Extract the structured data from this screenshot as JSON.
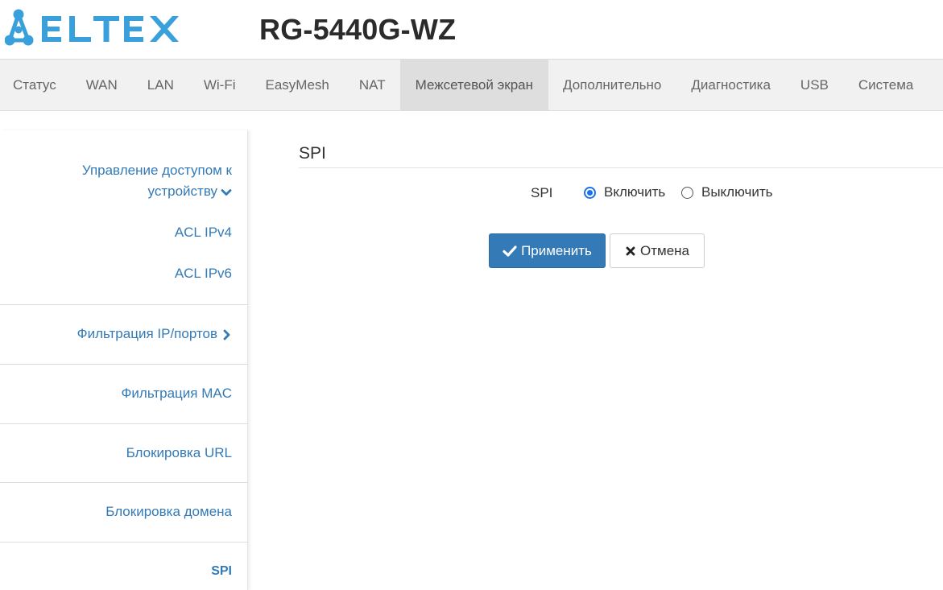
{
  "header": {
    "logo_text": "ELTEX",
    "model": "RG-5440G-WZ"
  },
  "topnav": {
    "tabs": [
      "Статус",
      "WAN",
      "LAN",
      "Wi-Fi",
      "EasyMesh",
      "NAT",
      "Межсетевой экран",
      "Дополнительно",
      "Диагностика",
      "USB",
      "Система"
    ],
    "active": "Межсетевой экран"
  },
  "sidebar": {
    "group_label": "Управление доступом к устройству",
    "acl_ipv4": "ACL IPv4",
    "acl_ipv6": "ACL IPv6",
    "ip_port_filter": "Фильтрация IP/портов",
    "mac_filter": "Фильтрация MAC",
    "url_block": "Блокировка URL",
    "domain_block": "Блокировка домена",
    "spi": "SPI"
  },
  "main": {
    "section_title": "SPI",
    "field_label": "SPI",
    "option_enable": "Включить",
    "option_disable": "Выключить",
    "selected": "Включить",
    "apply_label": "Применить",
    "cancel_label": "Отмена"
  },
  "colors": {
    "logo_blue": "#3aa0dc",
    "link": "#337ab7",
    "primary_button": "#337ab7",
    "radio_checked": "#1a73e8",
    "nav_bg": "#f1f1f1",
    "nav_active_bg": "#dedede"
  },
  "icons": {
    "logo": "eltex-network-logo",
    "group_chevron": "chevron-down-icon",
    "ip_filter_chevron": "chevron-right-icon",
    "apply": "check-icon",
    "cancel": "close-icon"
  }
}
